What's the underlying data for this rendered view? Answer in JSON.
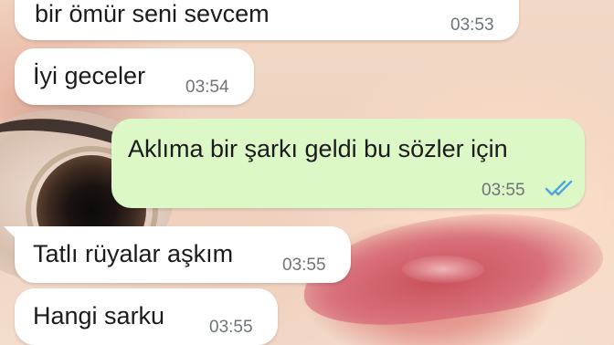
{
  "messages": [
    {
      "direction": "incoming",
      "text": "bir ömür seni sevcem",
      "time": "03:53"
    },
    {
      "direction": "incoming",
      "text": "İyi geceler",
      "time": "03:54"
    },
    {
      "direction": "outgoing",
      "text": "Aklıma bir şarkı geldi bu sözler için",
      "time": "03:55",
      "status": "read"
    },
    {
      "direction": "incoming",
      "text": "Tatlı rüyalar aşkım",
      "time": "03:55"
    },
    {
      "direction": "incoming",
      "text": "Hangi sarku",
      "time": "03:55"
    }
  ],
  "colors": {
    "incoming_bubble": "#ffffff",
    "outgoing_bubble": "#dcf8c6",
    "read_ticks": "#4fa3e0",
    "timestamp": "#6f7478"
  },
  "icons": {
    "read_receipt": "double-check-icon"
  }
}
